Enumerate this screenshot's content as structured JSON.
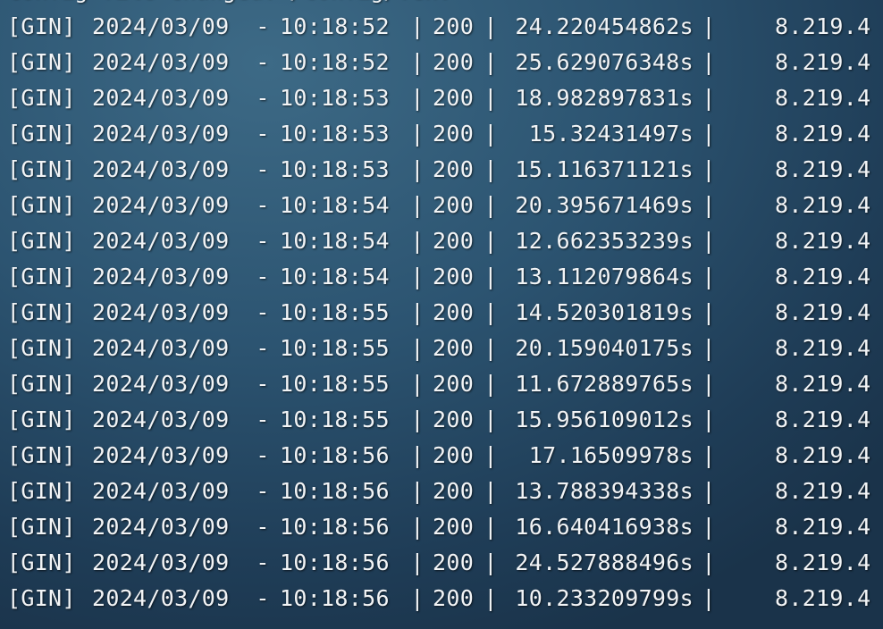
{
  "terminal": {
    "partial_top_line": "config file changed: /config/.env",
    "rows": [
      {
        "prefix": "[GIN]",
        "date": "2024/03/09",
        "dash": "-",
        "time": "10:18:52",
        "status": "200",
        "duration": "24.220454862s",
        "ip": "8.219.4"
      },
      {
        "prefix": "[GIN]",
        "date": "2024/03/09",
        "dash": "-",
        "time": "10:18:52",
        "status": "200",
        "duration": "25.629076348s",
        "ip": "8.219.4"
      },
      {
        "prefix": "[GIN]",
        "date": "2024/03/09",
        "dash": "-",
        "time": "10:18:53",
        "status": "200",
        "duration": "18.982897831s",
        "ip": "8.219.4"
      },
      {
        "prefix": "[GIN]",
        "date": "2024/03/09",
        "dash": "-",
        "time": "10:18:53",
        "status": "200",
        "duration": "15.32431497s",
        "ip": "8.219.4"
      },
      {
        "prefix": "[GIN]",
        "date": "2024/03/09",
        "dash": "-",
        "time": "10:18:53",
        "status": "200",
        "duration": "15.116371121s",
        "ip": "8.219.4"
      },
      {
        "prefix": "[GIN]",
        "date": "2024/03/09",
        "dash": "-",
        "time": "10:18:54",
        "status": "200",
        "duration": "20.395671469s",
        "ip": "8.219.4"
      },
      {
        "prefix": "[GIN]",
        "date": "2024/03/09",
        "dash": "-",
        "time": "10:18:54",
        "status": "200",
        "duration": "12.662353239s",
        "ip": "8.219.4"
      },
      {
        "prefix": "[GIN]",
        "date": "2024/03/09",
        "dash": "-",
        "time": "10:18:54",
        "status": "200",
        "duration": "13.112079864s",
        "ip": "8.219.4"
      },
      {
        "prefix": "[GIN]",
        "date": "2024/03/09",
        "dash": "-",
        "time": "10:18:55",
        "status": "200",
        "duration": "14.520301819s",
        "ip": "8.219.4"
      },
      {
        "prefix": "[GIN]",
        "date": "2024/03/09",
        "dash": "-",
        "time": "10:18:55",
        "status": "200",
        "duration": "20.159040175s",
        "ip": "8.219.4"
      },
      {
        "prefix": "[GIN]",
        "date": "2024/03/09",
        "dash": "-",
        "time": "10:18:55",
        "status": "200",
        "duration": "11.672889765s",
        "ip": "8.219.4"
      },
      {
        "prefix": "[GIN]",
        "date": "2024/03/09",
        "dash": "-",
        "time": "10:18:55",
        "status": "200",
        "duration": "15.956109012s",
        "ip": "8.219.4"
      },
      {
        "prefix": "[GIN]",
        "date": "2024/03/09",
        "dash": "-",
        "time": "10:18:56",
        "status": "200",
        "duration": "17.16509978s",
        "ip": "8.219.4"
      },
      {
        "prefix": "[GIN]",
        "date": "2024/03/09",
        "dash": "-",
        "time": "10:18:56",
        "status": "200",
        "duration": "13.788394338s",
        "ip": "8.219.4"
      },
      {
        "prefix": "[GIN]",
        "date": "2024/03/09",
        "dash": "-",
        "time": "10:18:56",
        "status": "200",
        "duration": "16.640416938s",
        "ip": "8.219.4"
      },
      {
        "prefix": "[GIN]",
        "date": "2024/03/09",
        "dash": "-",
        "time": "10:18:56",
        "status": "200",
        "duration": "24.527888496s",
        "ip": "8.219.4"
      },
      {
        "prefix": "[GIN]",
        "date": "2024/03/09",
        "dash": "-",
        "time": "10:18:56",
        "status": "200",
        "duration": "10.233209799s",
        "ip": "8.219.4"
      }
    ],
    "separator": "|"
  }
}
